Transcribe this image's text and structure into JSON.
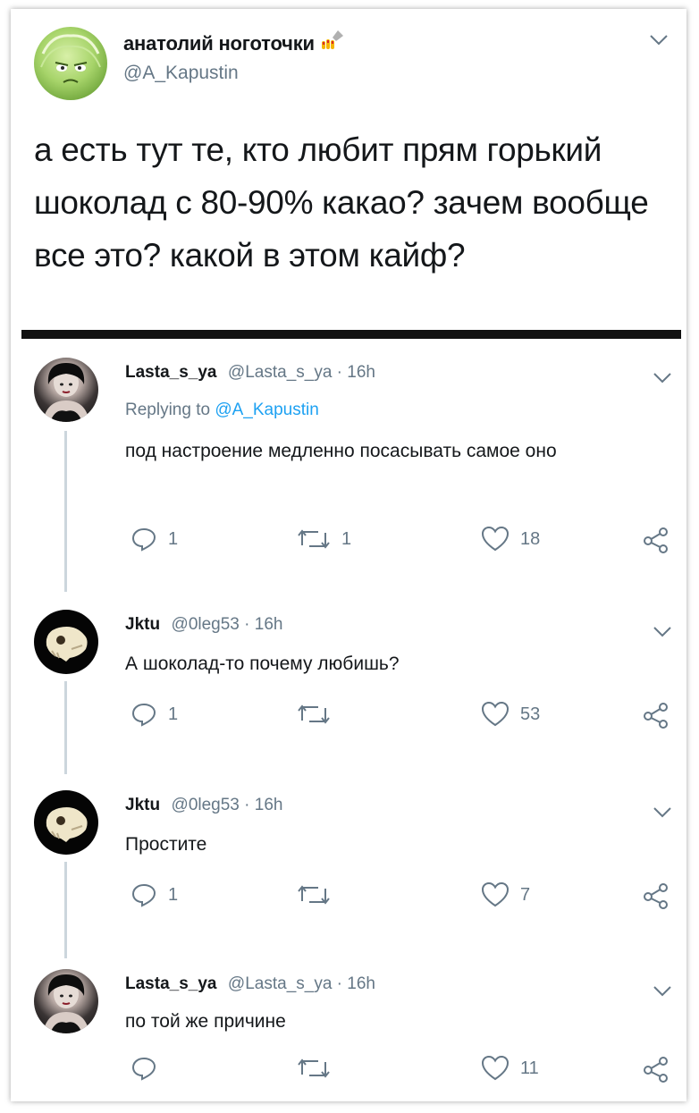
{
  "main_tweet": {
    "name": "анатолий ноготочки",
    "handle": "@A_Kapustin",
    "text": "а есть тут те, кто любит прям горький шоколад с 80-90% какао? зачем вообще все это? какой в этом кайф?",
    "avatar_icon": "cabbage-avatar",
    "name_emoji_icon": "nail-polish-icon"
  },
  "replies": [
    {
      "name": "Lasta_s_ya",
      "meta": "@Lasta_s_ya · 16h",
      "replying_prefix": "Replying to",
      "replying_handle": "@A_Kapustin",
      "text": "под настроение медленно посасывать самое оно",
      "replies_count": "1",
      "retweets_count": "1",
      "likes_count": "18"
    },
    {
      "name": "Jktu",
      "meta": "@0leg53 · 16h",
      "text": "А шоколад-то почему любишь?",
      "replies_count": "1",
      "retweets_count": "",
      "likes_count": "53"
    },
    {
      "name": "Jktu",
      "meta": "@0leg53 · 16h",
      "text": "Простите",
      "replies_count": "1",
      "retweets_count": "",
      "likes_count": "7"
    },
    {
      "name": "Lasta_s_ya",
      "meta": "@Lasta_s_ya · 16h",
      "text": "по той же причине",
      "replies_count": "",
      "retweets_count": "",
      "likes_count": "11"
    }
  ],
  "colors": {
    "text": "#14171a",
    "secondary": "#657786",
    "link": "#1da1f2",
    "thread_line": "#ccd6dd"
  }
}
